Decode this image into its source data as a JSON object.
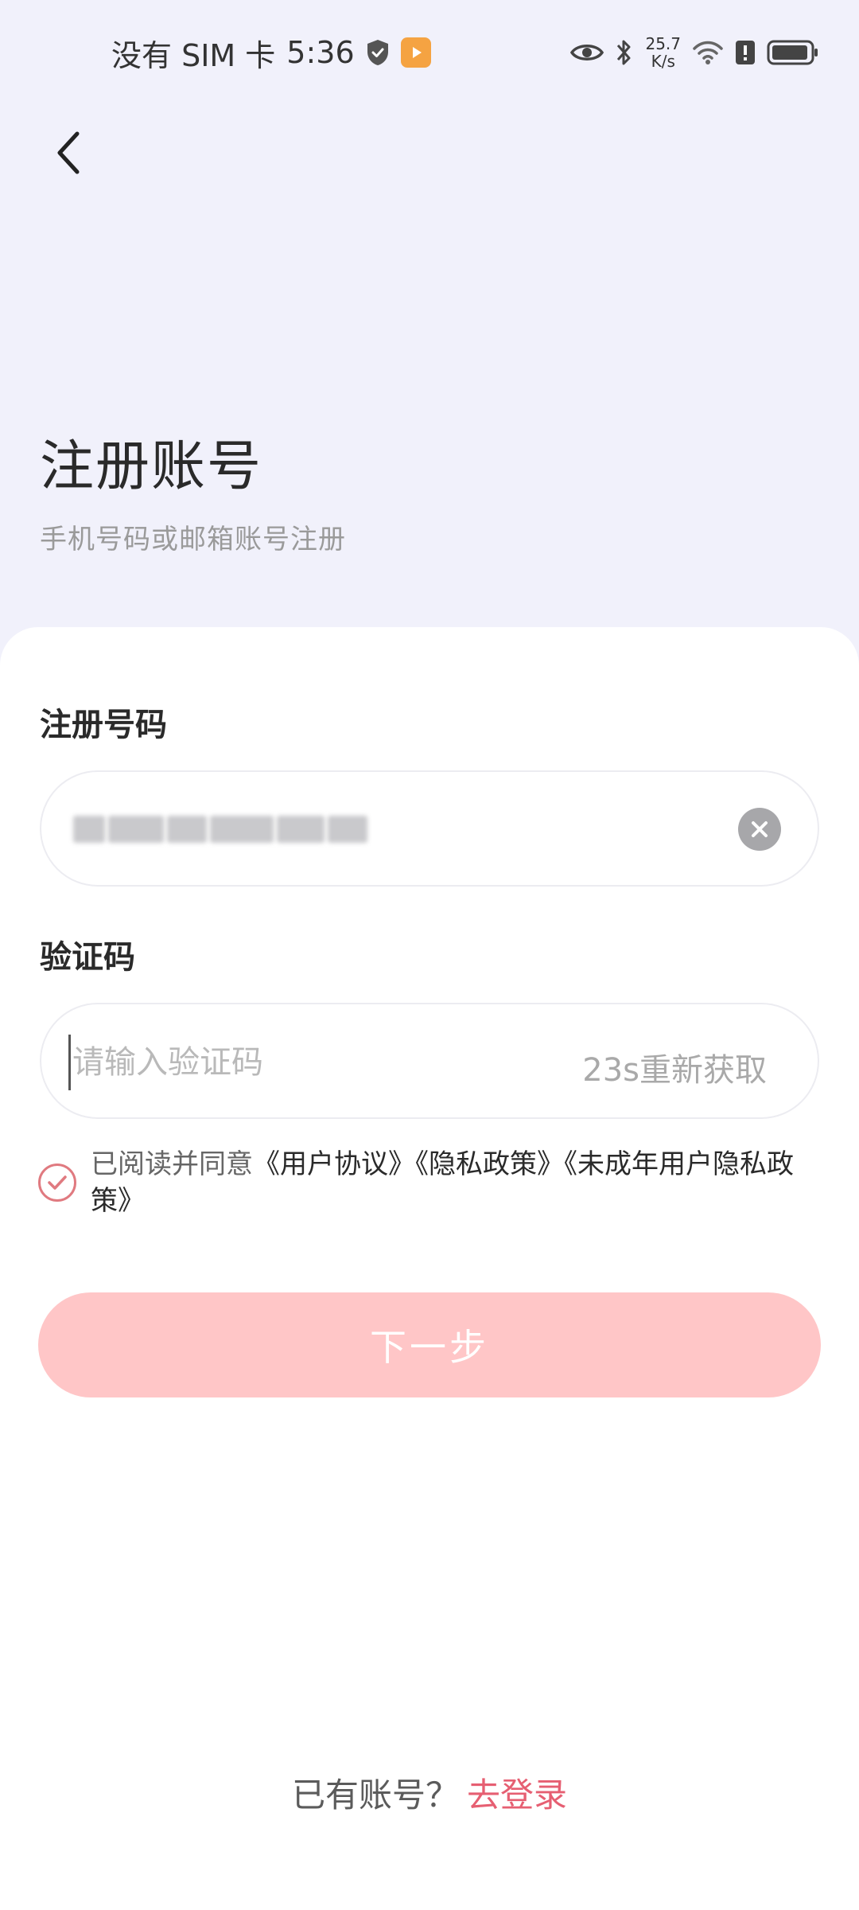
{
  "status_bar": {
    "carrier": "没有 SIM 卡",
    "time": "5:36",
    "net_speed_value": "25.7",
    "net_speed_unit": "K/s",
    "icons": [
      "shield-icon",
      "app-badge-icon",
      "eye-icon",
      "bluetooth-icon",
      "wifi-icon",
      "alert-icon",
      "battery-icon"
    ]
  },
  "header": {
    "back_icon": "chevron-left-icon",
    "title": "注册账号",
    "subtitle": "手机号码或邮箱账号注册"
  },
  "form": {
    "phone_label": "注册号码",
    "phone_value_masked": true,
    "clear_icon": "clear-icon",
    "code_label": "验证码",
    "code_placeholder": "请输入验证码",
    "code_value": "",
    "resend_label": "23s重新获取"
  },
  "agreement": {
    "checked": true,
    "prefix": "已阅读并同意",
    "links": [
      "《用户协议》",
      "《隐私政策》",
      "《未成年用户隐私政策》"
    ]
  },
  "next_button": {
    "label": "下一步",
    "enabled": false
  },
  "footer": {
    "prompt": "已有账号？",
    "login_link": "去登录"
  },
  "colors": {
    "page_background": "#f1f1fb",
    "card_background": "#ffffff",
    "accent": "#e65f72",
    "button_disabled": "#ffc6c7",
    "checkbox": "#e07a80"
  }
}
